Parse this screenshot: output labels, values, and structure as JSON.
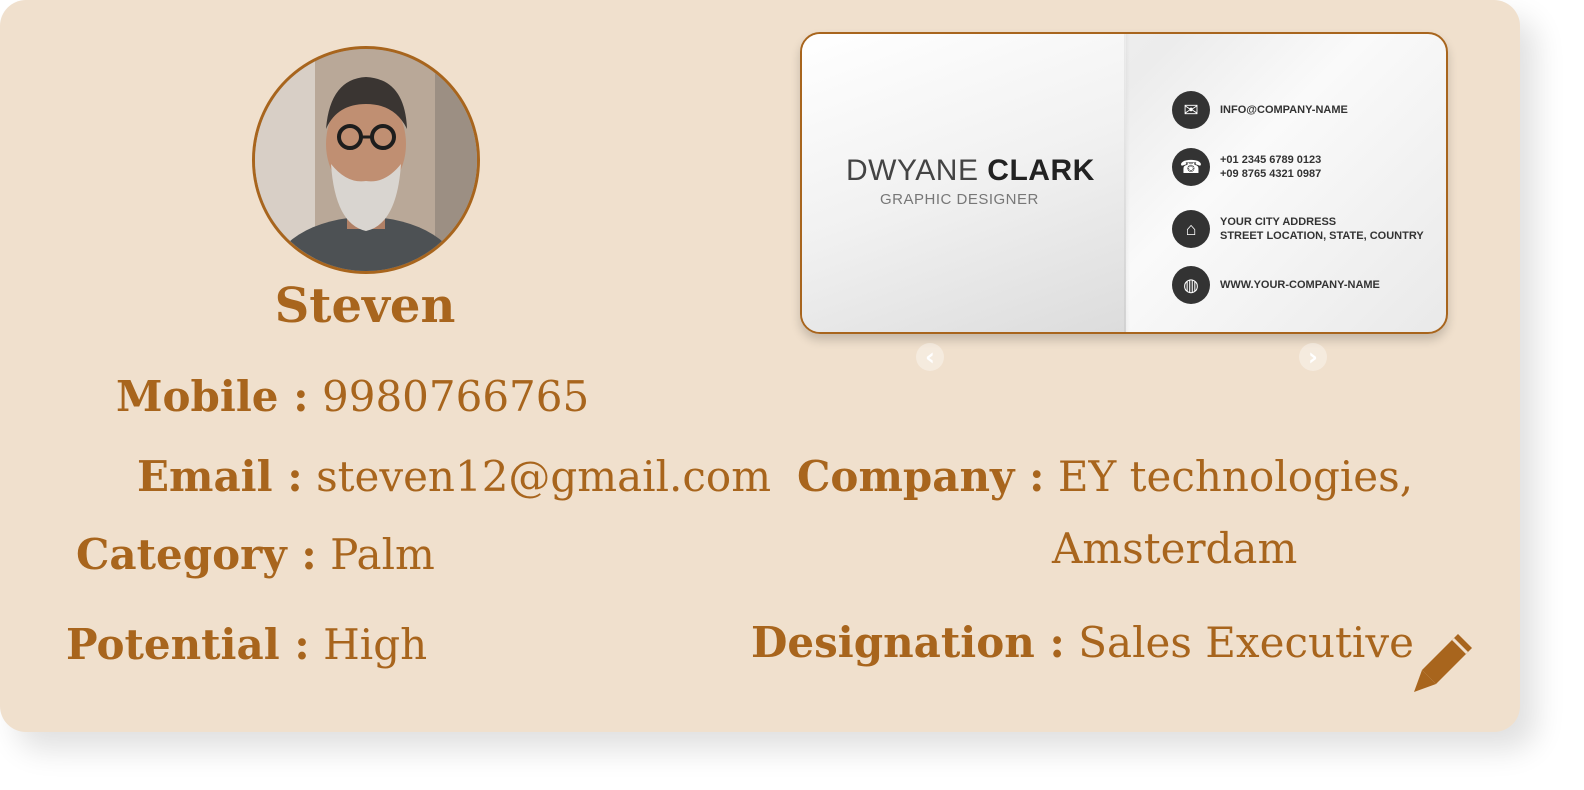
{
  "profile": {
    "name": "Steven",
    "avatar_icon": "profile-photo"
  },
  "fields": {
    "mobile": {
      "label": "Mobile :",
      "value": "9980766765"
    },
    "email": {
      "label": "Email :",
      "value": "steven12@gmail.com"
    },
    "category": {
      "label": "Category :",
      "value": "Palm"
    },
    "potential": {
      "label": "Potential :",
      "value": "High"
    },
    "company": {
      "label": "Company :",
      "value_line1": "EY technologies,",
      "value_line2": "Amsterdam"
    },
    "designation": {
      "label": "Designation :",
      "value": "Sales Executive"
    }
  },
  "business_card": {
    "first_name": "DWYANE",
    "last_name": "CLARK",
    "title": "GRAPHIC DESIGNER",
    "email": "INFO@COMPANY-NAME",
    "phone1": "+01 2345 6789 0123",
    "phone2": "+09 8765 4321 0987",
    "address1": "YOUR CITY ADDRESS",
    "address2": "STREET LOCATION, STATE, COUNTRY",
    "website": "WWW.YOUR-COMPANY-NAME"
  },
  "carousel": {
    "prev_icon": "chevron-left-icon",
    "next_icon": "chevron-right-icon"
  },
  "actions": {
    "edit_icon": "pencil-icon"
  },
  "colors": {
    "accent": "#a8651d",
    "card_bg": "#f0e0cd"
  }
}
